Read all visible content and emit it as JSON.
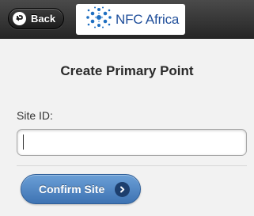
{
  "header": {
    "back_label": "Back",
    "back_icon": "back-arrow-icon",
    "logo_text": "NFC Africa",
    "logo_icon": "globe-network-icon"
  },
  "page": {
    "title": "Create Primary Point"
  },
  "form": {
    "site_id_label": "Site ID:",
    "site_id_value": "",
    "confirm_label": "Confirm Site",
    "confirm_icon": "chevron-right-circle-icon"
  },
  "colors": {
    "header_dark": "#262626",
    "accent_blue": "#3e73b3",
    "logo_blue": "#1f4e9a",
    "background": "#f2f2f2"
  }
}
